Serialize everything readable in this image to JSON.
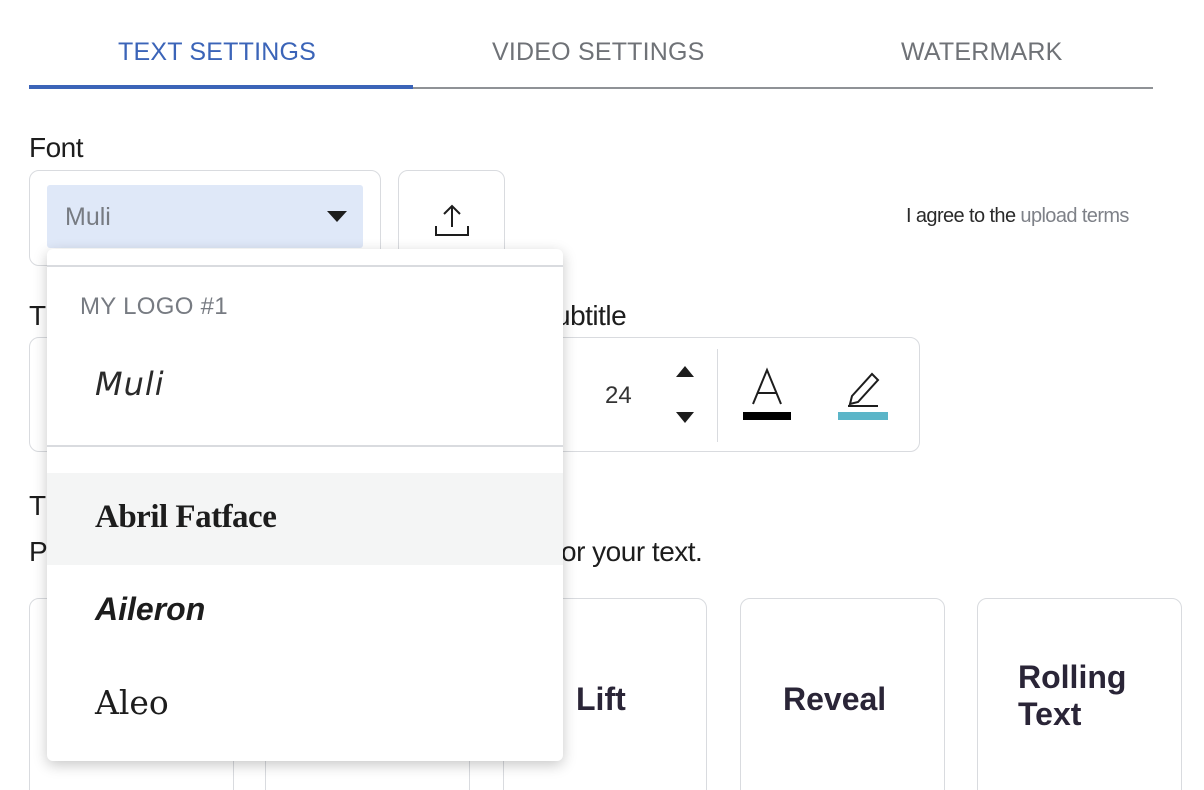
{
  "tabs": [
    {
      "label": "TEXT SETTINGS",
      "active": true
    },
    {
      "label": "VIDEO SETTINGS",
      "active": false
    },
    {
      "label": "WATERMARK",
      "active": false
    }
  ],
  "font_section": {
    "label": "Font",
    "selected_font": "Muli",
    "upload_icon": "upload-icon",
    "agree_prefix": "I agree to the ",
    "agree_link": "upload terms"
  },
  "subtitle_section": {
    "label_visible": "Subtitle",
    "label_partial": "ubtitle",
    "t_fragment": "T",
    "font_size": "24",
    "text_color": "#000000",
    "highlight_color": "#5bb5c8"
  },
  "animation_section": {
    "title_fragment": "T",
    "helper_prefix_fragment": "P",
    "helper_text_fragment": "or your text.",
    "cards": [
      {
        "label": ""
      },
      {
        "label": ""
      },
      {
        "label": "Lift"
      },
      {
        "label": "Reveal"
      },
      {
        "label": "Rolling Text"
      }
    ]
  },
  "font_dropdown": {
    "group_label": "MY LOGO #1",
    "group_items": [
      "Muli"
    ],
    "items": [
      "Abril Fatface",
      "Aileron",
      "Aleo"
    ],
    "hovered_item": "Abril Fatface"
  },
  "colors": {
    "accent": "#3b64b8",
    "select_bg": "#dfe8f8",
    "highlight_swatch": "#5bb5c8"
  }
}
